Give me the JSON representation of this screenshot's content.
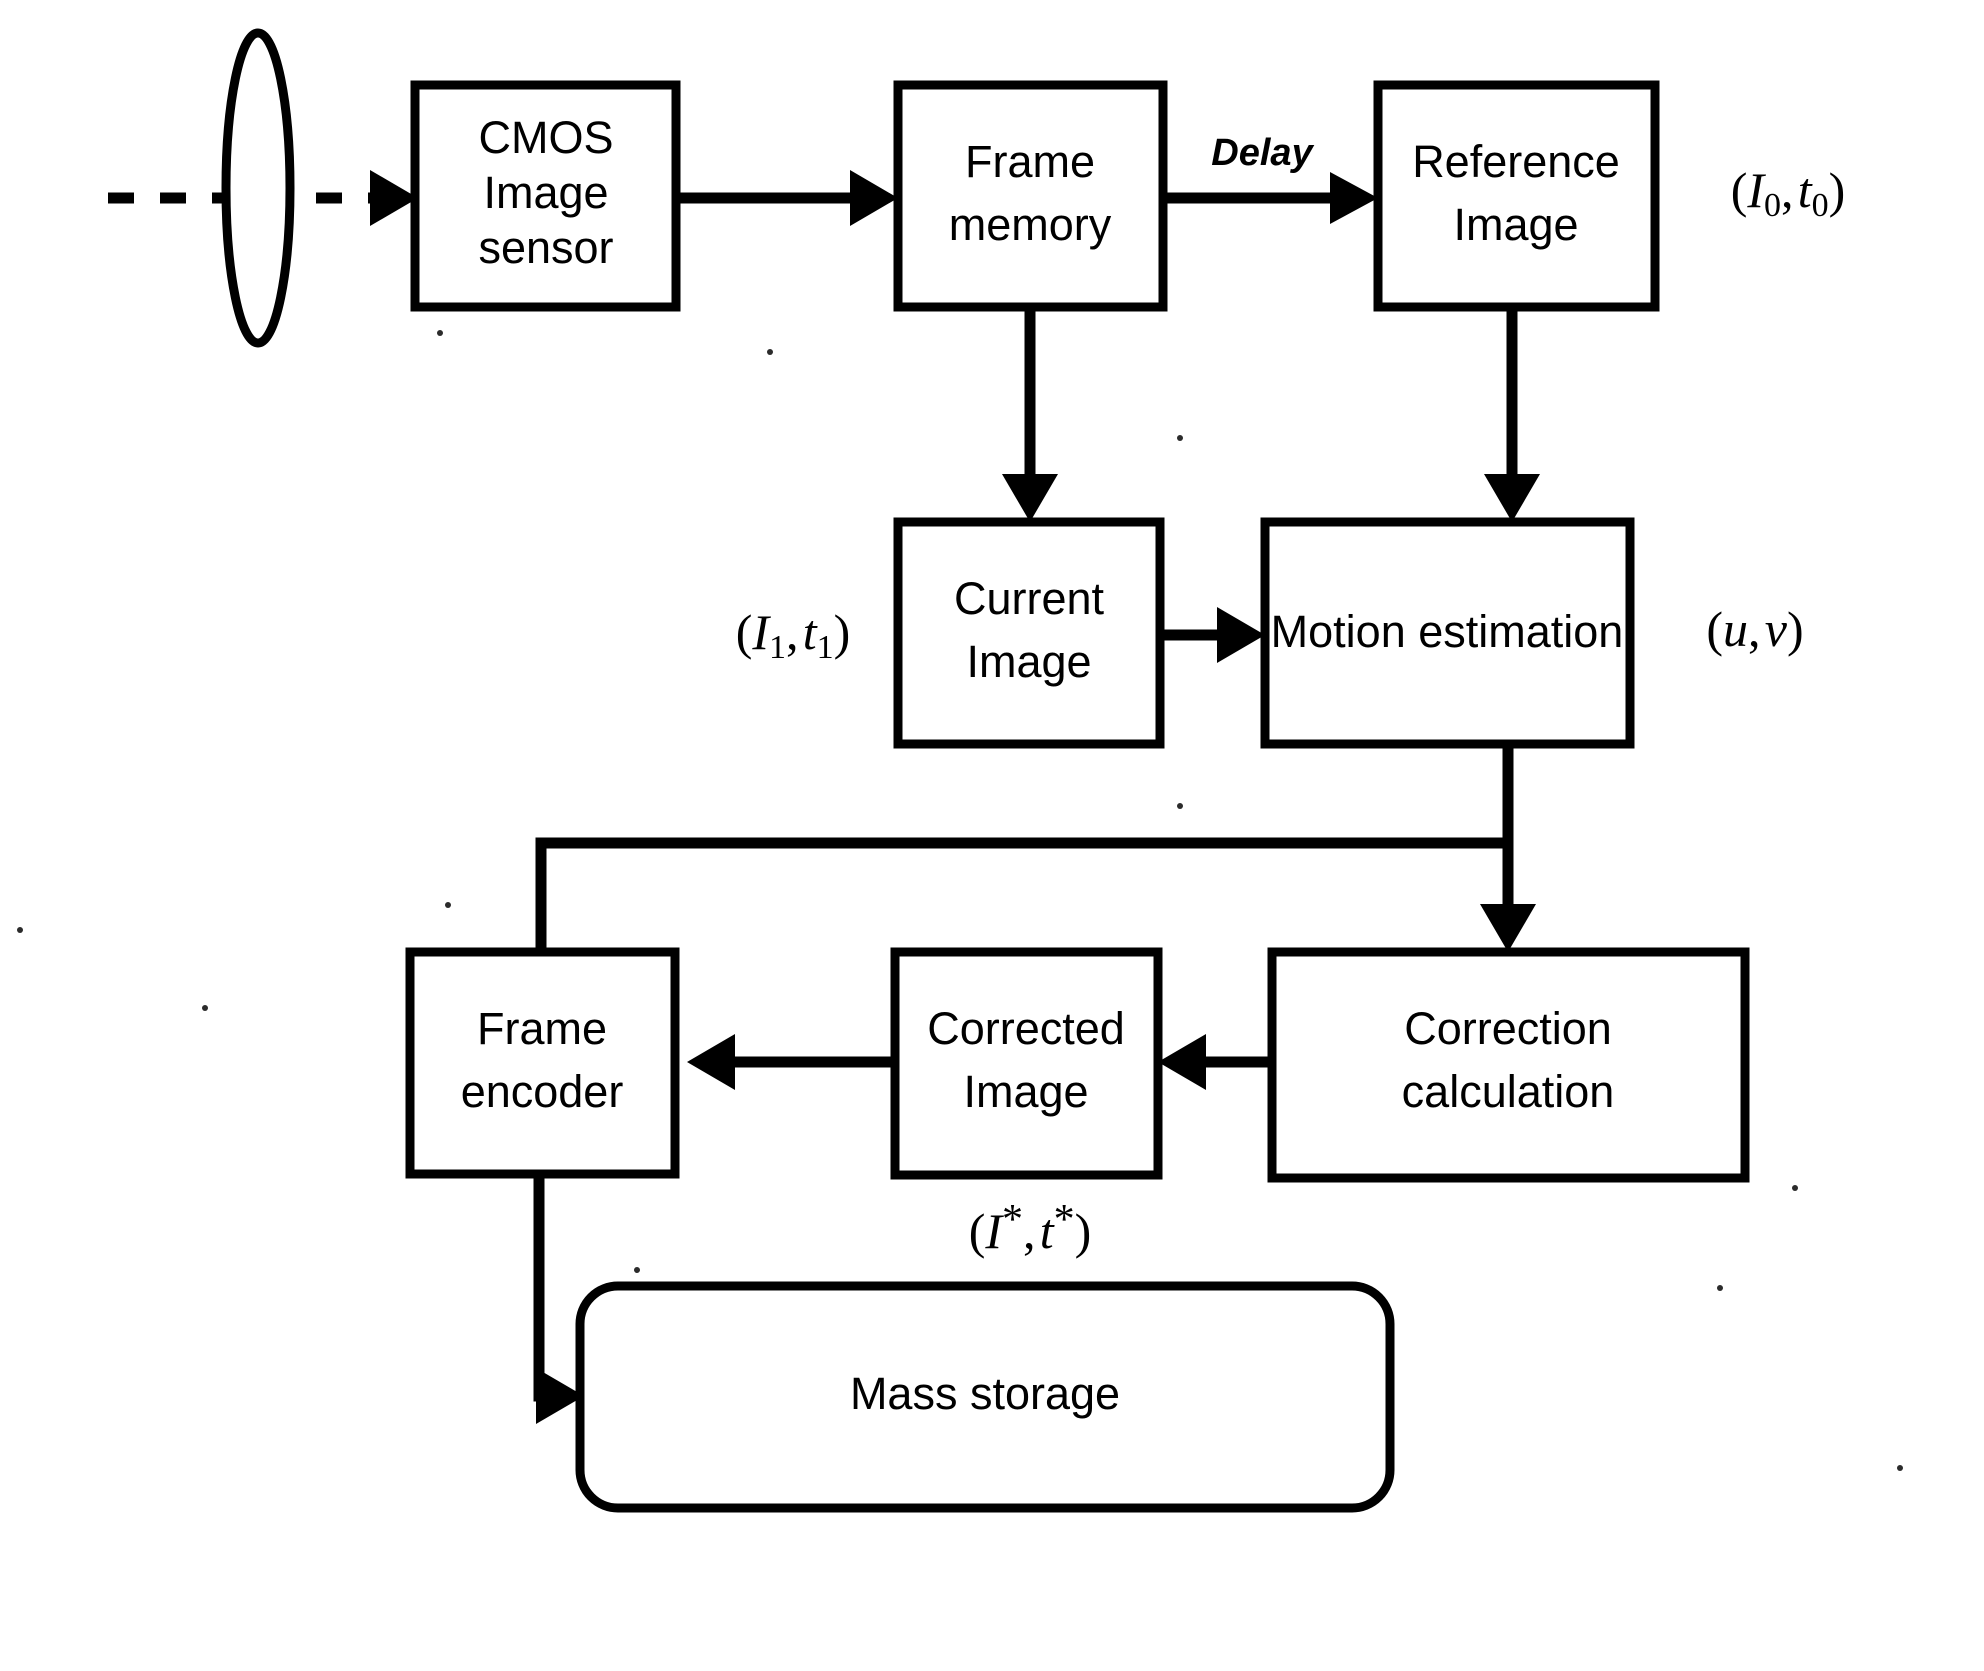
{
  "diagram": {
    "title": "CMOS image sensor motion-correction pipeline block diagram",
    "stroke_color": "#000000",
    "fill_color": "#ffffff",
    "nodes": [
      {
        "id": "lens",
        "name": "lens",
        "shape": "ellipse",
        "label": ""
      },
      {
        "id": "cmos",
        "name": "cmos-image-sensor",
        "shape": "rect",
        "label": "CMOS\nImage\nsensor",
        "line1": "CMOS",
        "line2": "Image",
        "line3": "sensor"
      },
      {
        "id": "framemem",
        "name": "frame-memory",
        "shape": "rect",
        "label": "Frame\nmemory",
        "line1": "Frame",
        "line2": "memory"
      },
      {
        "id": "refimage",
        "name": "reference-image",
        "shape": "rect",
        "label": "Reference\nImage",
        "line1": "Reference",
        "line2": "Image"
      },
      {
        "id": "curimage",
        "name": "current-image",
        "shape": "rect",
        "label": "Current\nImage",
        "line1": "Current",
        "line2": "Image"
      },
      {
        "id": "motionest",
        "name": "motion-estimation",
        "shape": "rect",
        "label": "Motion estimation",
        "line1": "Motion estimation"
      },
      {
        "id": "corrcalc",
        "name": "correction-calculation",
        "shape": "rect",
        "label": "Correction\ncalculation",
        "line1": "Correction",
        "line2": "calculation"
      },
      {
        "id": "corrimage",
        "name": "corrected-image",
        "shape": "rect",
        "label": "Corrected\nImage",
        "line1": "Corrected",
        "line2": "Image"
      },
      {
        "id": "frameenc",
        "name": "frame-encoder",
        "shape": "rect",
        "label": "Frame\nencoder",
        "line1": "Frame",
        "line2": "encoder"
      },
      {
        "id": "massstorage",
        "name": "mass-storage",
        "shape": "rounded-rect",
        "label": "Mass storage",
        "line1": "Mass storage"
      }
    ],
    "edge_labels": [
      {
        "id": "delay",
        "name": "delay-edge-label",
        "text": "Delay",
        "style": "italic-bold"
      }
    ],
    "signal_labels": [
      {
        "id": "ref_signal",
        "name": "reference-image-signal-label",
        "open": "(",
        "var1": "I",
        "sub1": "0",
        "sep": ",",
        "var2": "t",
        "sub2": "0",
        "close": ")",
        "text": "(I0, t0)"
      },
      {
        "id": "cur_signal",
        "name": "current-image-signal-label",
        "open": "(",
        "var1": "I",
        "sub1": "1",
        "sep": ",",
        "var2": "t",
        "sub2": "1",
        "close": ")",
        "text": "(I1, t1)"
      },
      {
        "id": "mv_signal",
        "name": "motion-vector-signal-label",
        "open": "(",
        "var1": "u",
        "sub1": "",
        "sep": ",",
        "var2": "v",
        "sub2": "",
        "close": ")",
        "text": "(u, v)"
      },
      {
        "id": "corr_signal",
        "name": "corrected-image-signal-label",
        "open": "(",
        "var1": "I",
        "sub1": "*",
        "sep": ",",
        "var2": "t",
        "sub2": "*",
        "close": ")",
        "text": "(I*, t*)"
      }
    ],
    "connections": [
      {
        "id": "c1",
        "name": "light-ray-connector",
        "from": "scene",
        "to": "cmos",
        "style": "dashed",
        "arrow": true
      },
      {
        "id": "c2",
        "name": "cmos-to-frame-memory-connector",
        "from": "cmos",
        "to": "framemem",
        "style": "solid",
        "arrow": true
      },
      {
        "id": "c3",
        "name": "frame-memory-to-reference-image-connector",
        "from": "framemem",
        "to": "refimage",
        "style": "solid",
        "arrow": true,
        "label": "Delay"
      },
      {
        "id": "c4",
        "name": "frame-memory-to-current-image-connector",
        "from": "framemem",
        "to": "curimage",
        "style": "solid",
        "arrow": true
      },
      {
        "id": "c5",
        "name": "reference-image-to-motion-estimation-connector",
        "from": "refimage",
        "to": "motionest",
        "style": "solid",
        "arrow": true
      },
      {
        "id": "c6",
        "name": "current-image-to-motion-estimation-connector",
        "from": "curimage",
        "to": "motionest",
        "style": "solid",
        "arrow": true
      },
      {
        "id": "c7",
        "name": "motion-estimation-to-correction-calculation-connector",
        "from": "motionest",
        "to": "corrcalc",
        "style": "solid",
        "arrow": true
      },
      {
        "id": "c8",
        "name": "motion-estimation-to-frame-encoder-connector",
        "from": "motionest",
        "to": "frameenc",
        "style": "solid",
        "arrow": true
      },
      {
        "id": "c9",
        "name": "correction-calculation-to-corrected-image-connector",
        "from": "corrcalc",
        "to": "corrimage",
        "style": "solid",
        "arrow": true
      },
      {
        "id": "c10",
        "name": "corrected-image-to-frame-encoder-connector",
        "from": "corrimage",
        "to": "frameenc",
        "style": "solid",
        "arrow": true
      },
      {
        "id": "c11",
        "name": "frame-encoder-to-mass-storage-connector",
        "from": "frameenc",
        "to": "massstorage",
        "style": "solid",
        "arrow": true
      }
    ]
  }
}
